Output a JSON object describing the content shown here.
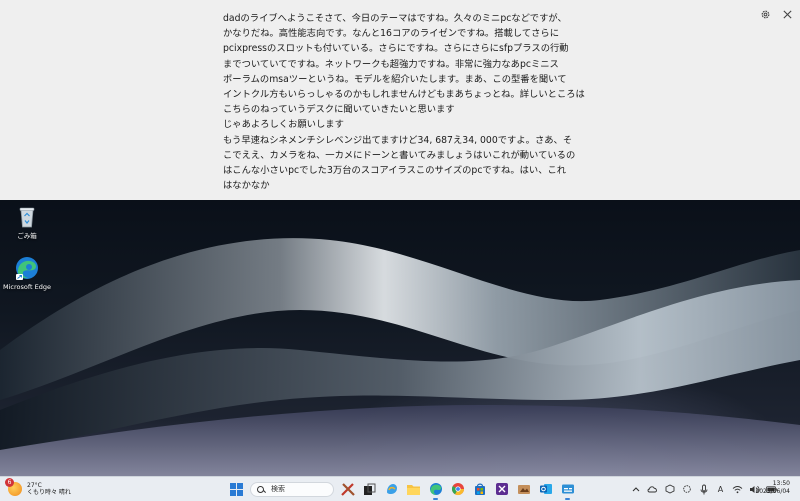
{
  "captions": {
    "lines": [
      "dadのライブへようこそさて、今日のテーマはですね。久々のミニpcなどですが、",
      "かなりだね。高性能志向です。なんと16コアのライゼンですね。搭載してさらに",
      "pcixpressのスロットも付いている。さらにですね。さらにさらにsfpプラスの行動",
      "までついていてですね。ネットワークも超強力ですね。非常に強力なあpcミニス",
      "ポーラムのmsaツーというね。モデルを紹介いたします。まあ、この型番を聞いて",
      "イントクル方もいらっしゃるのかもしれませんけどもまあちょっとね。詳しいところは",
      "こちらのねっていうデスクに聞いていきたいと思います",
      "じゃあよろしくお願いします",
      "もう早速ねシネメンチシレベンジ出てますけど34, 687え34, 000ですよ。さあ、そ",
      "こでええ、カメラをね、一カメにドーンと書いてみましょうはいこれが動いているの",
      "はこんな小さいpcでした3万台のスコアイラスこのサイズのpcですね。はい、これ",
      "はなかなか"
    ]
  },
  "desktop": {
    "icons": [
      {
        "label": "ごみ箱",
        "icon": "recycle-bin-icon"
      },
      {
        "label": "Microsoft Edge",
        "icon": "edge-icon"
      }
    ]
  },
  "taskbar": {
    "weather": {
      "temp": "27°C",
      "condition": "くもり時々 晴れ",
      "badge": "6"
    },
    "search_placeholder": "検索",
    "clock": {
      "time": "13:50",
      "date": "2025/06/04"
    },
    "ime": "A"
  },
  "colors": {
    "accent": "#3a82d6",
    "caption_bg": "#efefef",
    "taskbar_bg": "#e9edf2"
  }
}
